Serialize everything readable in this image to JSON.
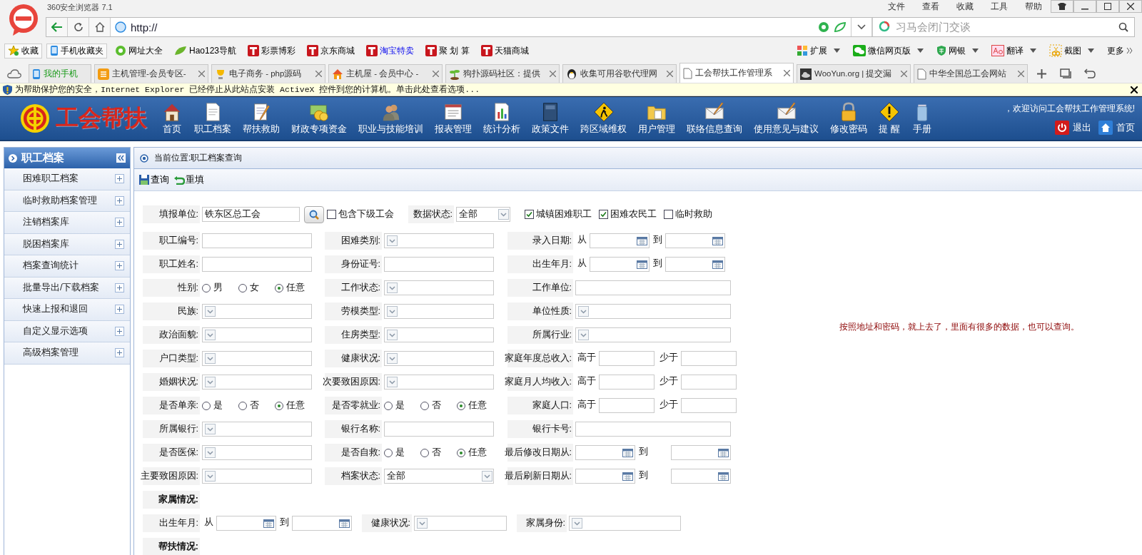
{
  "browser": {
    "title": "360安全浏览器 7.1",
    "menu": [
      "文件",
      "查看",
      "收藏",
      "工具",
      "帮助"
    ],
    "address": "http://",
    "search": {
      "placeholder": "习马会闭门交谈"
    },
    "bookmarks": [
      {
        "label": "收藏",
        "kind": "star",
        "featured": false
      },
      {
        "label": "手机收藏夹",
        "kind": "phone",
        "featured": false
      },
      {
        "label": "网址大全",
        "kind": "site",
        "featured": false
      },
      {
        "label": "Hao123导航",
        "kind": "hao",
        "featured": false
      },
      {
        "label": "彩票博彩",
        "kind": "t",
        "featured": false
      },
      {
        "label": "京东商城",
        "kind": "t",
        "featured": false
      },
      {
        "label": "淘宝特卖",
        "kind": "t",
        "featured": true
      },
      {
        "label": "聚 划 算",
        "kind": "t",
        "featured": false
      },
      {
        "label": "天猫商城",
        "kind": "t",
        "featured": false
      }
    ],
    "tools": [
      {
        "label": "扩展",
        "kind": "blocks"
      },
      {
        "label": "微信网页版",
        "kind": "chat"
      },
      {
        "label": "网银",
        "kind": "shield"
      },
      {
        "label": "翻译",
        "kind": "translate"
      },
      {
        "label": "截图",
        "kind": "scissors"
      },
      {
        "label": "更多",
        "kind": "more"
      }
    ],
    "tabs": [
      {
        "label": "我的手机",
        "kind": "phone",
        "selected": false,
        "pinned": true
      },
      {
        "label": "主机管理-会员专区-",
        "kind": "app",
        "selected": false,
        "pinned": false
      },
      {
        "label": "电子商务 - php源码",
        "kind": "cup",
        "selected": false,
        "pinned": false
      },
      {
        "label": "主机屋 - 会员中心 -",
        "kind": "house",
        "selected": false,
        "pinned": false
      },
      {
        "label": "狗扑源码社区：提供",
        "kind": "sprout",
        "selected": false,
        "pinned": false
      },
      {
        "label": "收集可用谷歌代理网",
        "kind": "penguin",
        "selected": false,
        "pinned": false
      },
      {
        "label": "工会帮扶工作管理系",
        "kind": "page",
        "selected": true,
        "pinned": false
      },
      {
        "label": "WooYun.org | 提交漏",
        "kind": "cloud",
        "selected": false,
        "pinned": false
      },
      {
        "label": "中华全国总工会网站",
        "kind": "page",
        "selected": false,
        "pinned": false
      }
    ],
    "infobar": "为帮助保护您的安全，Internet Explorer 已经停止从此站点安装 ActiveX 控件到您的计算机。单击此处查看选项..."
  },
  "app": {
    "logo": "工会帮扶",
    "nav": [
      {
        "label": "首页",
        "kind": "house"
      },
      {
        "label": "职工档案",
        "kind": "document"
      },
      {
        "label": "帮扶救助",
        "kind": "notepad"
      },
      {
        "label": "财政专项资金",
        "kind": "coins"
      },
      {
        "label": "职业与技能培训",
        "kind": "people"
      },
      {
        "label": "报表管理",
        "kind": "form"
      },
      {
        "label": "统计分析",
        "kind": "chart"
      },
      {
        "label": "政策文件",
        "kind": "book"
      },
      {
        "label": "跨区域维权",
        "kind": "sign"
      },
      {
        "label": "用户管理",
        "kind": "folder"
      },
      {
        "label": "联络信息查询",
        "kind": "mail"
      },
      {
        "label": "使用意见与建议",
        "kind": "mail"
      },
      {
        "label": "修改密码",
        "kind": "lock"
      },
      {
        "label": "提 醒",
        "kind": "alert"
      },
      {
        "label": "手册",
        "kind": "jar"
      }
    ],
    "welcome": "，欢迎访问工会帮扶工作管理系统!",
    "links": [
      {
        "label": "退出",
        "kind": "power"
      },
      {
        "label": "首页",
        "kind": "home"
      }
    ]
  },
  "sidebar": {
    "title": "职工档案",
    "items": [
      "困难职工档案",
      "临时救助档案管理",
      "注销档案库",
      "脱困档案库",
      "档案查询统计",
      "批量导出/下载档案",
      "快速上报和退回",
      "自定义显示选项",
      "高级档案管理"
    ]
  },
  "main": {
    "breadcrumb": "当前位置:职工档案查询",
    "toolbar": [
      {
        "label": "查询",
        "kind": "save"
      },
      {
        "label": "重填",
        "kind": "undo"
      }
    ],
    "first_row": {
      "unit": {
        "label": "填报单位:",
        "value": "铁东区总工会",
        "checkbox": {
          "label": "包含下级工会",
          "checked": false
        }
      },
      "status": {
        "label": "数据状态:",
        "value": "全部"
      },
      "categories": [
        {
          "label": "城镇困难职工",
          "checked": true
        },
        {
          "label": "困难农民工",
          "checked": true
        },
        {
          "label": "临时救助",
          "checked": false
        }
      ]
    },
    "rows": [
      [
        {
          "kind": "text",
          "label": "职工编号:"
        },
        {
          "kind": "select",
          "label": "困难类别:"
        },
        {
          "kind": "daterange",
          "label": "录入日期:",
          "from": "从",
          "to": "到"
        }
      ],
      [
        {
          "kind": "text",
          "label": "职工姓名:"
        },
        {
          "kind": "text",
          "label": "身份证号:"
        },
        {
          "kind": "daterange",
          "label": "出生年月:",
          "from": "从",
          "to": "到"
        }
      ],
      [
        {
          "kind": "radio",
          "label": "性别:",
          "options": [
            {
              "label": "男",
              "selected": false
            },
            {
              "label": "女",
              "selected": false
            },
            {
              "label": "任意",
              "selected": true
            }
          ]
        },
        {
          "kind": "select",
          "label": "工作状态:"
        },
        {
          "kind": "text",
          "label": "工作单位:"
        }
      ],
      [
        {
          "kind": "select",
          "label": "民族:"
        },
        {
          "kind": "select",
          "label": "劳模类型:"
        },
        {
          "kind": "select",
          "label": "单位性质:"
        }
      ],
      [
        {
          "kind": "select",
          "label": "政治面貌:"
        },
        {
          "kind": "select",
          "label": "住房类型:"
        },
        {
          "kind": "select",
          "label": "所属行业:"
        }
      ],
      [
        {
          "kind": "select",
          "label": "户口类型:"
        },
        {
          "kind": "select",
          "label": "健康状况:"
        },
        {
          "kind": "range",
          "label": "家庭年度总收入:",
          "above": "高于",
          "below": "少于"
        }
      ],
      [
        {
          "kind": "select",
          "label": "婚姻状况:"
        },
        {
          "kind": "select",
          "label": "次要致困原因:"
        },
        {
          "kind": "range",
          "label": "家庭月人均收入:",
          "above": "高于",
          "below": "少于"
        }
      ],
      [
        {
          "kind": "radio",
          "label": "是否单亲:",
          "options": [
            {
              "label": "是",
              "selected": false
            },
            {
              "label": "否",
              "selected": false
            },
            {
              "label": "任意",
              "selected": true
            }
          ]
        },
        {
          "kind": "radio",
          "label": "是否零就业:",
          "options": [
            {
              "label": "是",
              "selected": false
            },
            {
              "label": "否",
              "selected": false
            },
            {
              "label": "任意",
              "selected": true
            }
          ]
        },
        {
          "kind": "range",
          "label": "家庭人口:",
          "above": "高于",
          "below": "少于"
        }
      ],
      [
        {
          "kind": "select",
          "label": "所属银行:"
        },
        {
          "kind": "text",
          "label": "银行名称:"
        },
        {
          "kind": "text",
          "label": "银行卡号:"
        }
      ],
      [
        {
          "kind": "select",
          "label": "是否医保:"
        },
        {
          "kind": "radio",
          "label": "是否自救:",
          "options": [
            {
              "label": "是",
              "selected": false
            },
            {
              "label": "否",
              "selected": false
            },
            {
              "label": "任意",
              "selected": true
            }
          ]
        },
        {
          "kind": "daterange",
          "label": "最后修改日期从:",
          "to": "到"
        }
      ],
      [
        {
          "kind": "select",
          "label": "主要致困原因:"
        },
        {
          "kind": "select",
          "label": "档案状态:",
          "value": "全部"
        },
        {
          "kind": "daterange",
          "label": "最后刷新日期从:",
          "to": "到"
        }
      ]
    ],
    "family": {
      "heading": "家属情况:",
      "fields": [
        {
          "kind": "daterange",
          "label": "出生年月:",
          "from": "从",
          "to": "到"
        },
        {
          "kind": "select",
          "label": "健康状况:"
        },
        {
          "kind": "select",
          "label": "家属身份:"
        }
      ]
    },
    "assistance": {
      "heading": "帮扶情况:"
    },
    "note": "按照地址和密码，就上去了，里面有很多的数据，也可以查询。"
  }
}
